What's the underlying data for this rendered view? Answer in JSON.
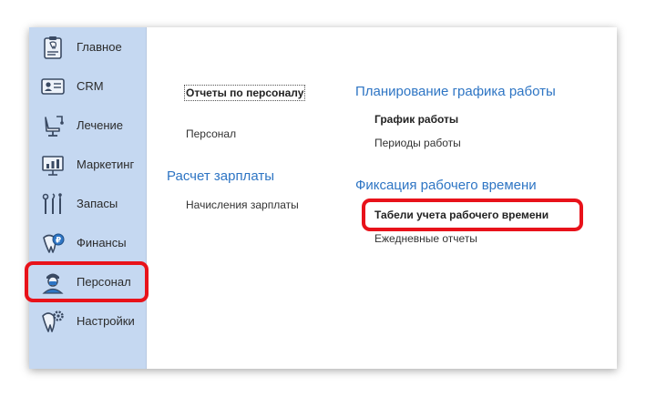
{
  "sidebar": {
    "items": [
      {
        "label": "Главное",
        "icon": "tooth-clipboard-icon"
      },
      {
        "label": "CRM",
        "icon": "id-card-icon"
      },
      {
        "label": "Лечение",
        "icon": "dental-chair-icon"
      },
      {
        "label": "Маркетинг",
        "icon": "presentation-chart-icon"
      },
      {
        "label": "Запасы",
        "icon": "dental-tools-icon"
      },
      {
        "label": "Финансы",
        "icon": "tooth-coin-icon"
      },
      {
        "label": "Персонал",
        "icon": "doctor-icon"
      },
      {
        "label": "Настройки",
        "icon": "tooth-gear-icon"
      }
    ]
  },
  "left_column": {
    "reports_link": "Отчеты по персоналу",
    "personnel_link": "Персонал",
    "salary_title": "Расчет зарплаты",
    "salary_link": "Начисления зарплаты"
  },
  "right_column": {
    "schedule_title": "Планирование графика работы",
    "schedule_link": "График работы",
    "periods_link": "Периоды работы",
    "time_title": "Фиксация рабочего времени",
    "timesheet_link": "Табели учета рабочего времени",
    "daily_link": "Ежедневные отчеты"
  },
  "colors": {
    "sidebar_bg": "#c5d8f1",
    "group_title": "#2e75c4",
    "highlight": "#e8121a"
  }
}
